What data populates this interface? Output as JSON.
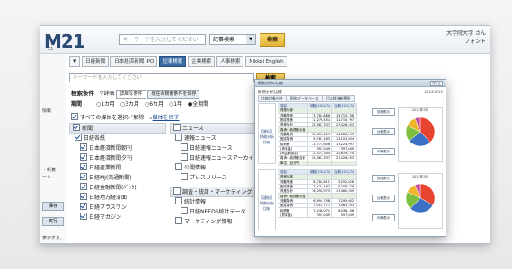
{
  "header": {
    "logo": "M21",
    "logo_sub": "21",
    "keyword_placeholder": "キーワードを入力してください",
    "select_value": "記事検索",
    "search_label": "検索",
    "user_line1": "大学院大学 さん",
    "user_line2": "フォント"
  },
  "left_panel": {
    "t1": "情報",
    "t2": "・新着",
    "t3": "ート",
    "btn1": "保存",
    "btn2": "実行",
    "t4": "表示する。"
  },
  "toolbar": {
    "items": [
      "▼",
      "日経新聞",
      "日本経済新聞 IPO",
      "記事検索",
      "企業検索",
      "人事検索",
      "Nikkei English"
    ]
  },
  "search": {
    "placeholder": "キーワードを入力してください",
    "button": "検索"
  },
  "conditions": {
    "label": "検索条件",
    "detail": "詳細",
    "select": "詳細な条件",
    "btn": "現在の検索条件を保存",
    "period_label": "期間",
    "periods": [
      "1カ月",
      "3カ月",
      "6カ月",
      "1年",
      "全期間"
    ]
  },
  "select_all": {
    "text": "すべての媒体を選択／解除",
    "link": "媒体を探す"
  },
  "media_left": {
    "head": "新聞",
    "group": "日経各紙",
    "items": [
      "日本経済新聞朝刊",
      "日本経済新聞夕刊",
      "日経産業新聞",
      "日経MJ(流通新聞)",
      "日経金融新聞(ﾊﾞｯｸ)",
      "日経地方経済面",
      "日経プラスワン",
      "日経マガジン"
    ]
  },
  "media_right": {
    "head": "ニュース",
    "group1": "速報ニュース",
    "items1": [
      "日経速報ニュース",
      "日経速報ニュースアーカイブ"
    ],
    "group2": "公開情報",
    "items2": [
      "プレスリリース"
    ],
    "head2": "調査・統計・マーケティング",
    "group3": "統計情報",
    "items3": [
      "日経NEEDS統計データ"
    ],
    "group4": "マーケティング情報"
  },
  "popup": {
    "bar": "財務分析の比較",
    "close": "閉じる",
    "title": "財務分析比較",
    "date": "2012/4/10",
    "tabs": [
      "比較対象会社",
      "財務データベース",
      "日本経済新聞社"
    ],
    "sections": [
      {
        "label": "【単体】財務分析比較",
        "header": [
          "項目",
          "前期(2011/3)",
          "当期(2012/3)"
        ],
        "rows": [
          [
            "資産の部",
            "",
            ""
          ],
          [
            "流動資産",
            "13,784,886",
            "15,715,706"
          ],
          [
            "固定資産",
            "11,276,451",
            "11,710,797"
          ],
          [
            "資産合計",
            "25,061,337",
            "27,426,503"
          ],
          [
            "負債・純資産の部",
            "",
            ""
          ],
          [
            "流動負債",
            "12,653,159",
            "14,680,293"
          ],
          [
            "固定負債",
            "9,787,263",
            "11,102,004"
          ],
          [
            "純資産",
            "12,773,606",
            "13,224,997"
          ],
          [
            "(資本金)",
            "397,049",
            "397,049"
          ],
          [
            "(利益剰余金)",
            "12,373,345",
            "12,819,274"
          ],
          [
            "負債・純資産合計",
            "25,061,337",
            "27,426,503"
          ],
          [
            "単位：百万円",
            "",
            ""
          ]
        ],
        "pie_title": "2012年3月"
      },
      {
        "label": "【連結】財務分析比較",
        "header": [
          "項目",
          "前期(2011/3)",
          "当期(2012/3)"
        ],
        "rows": [
          [
            "資産の部",
            "",
            ""
          ],
          [
            "流動資産",
            "8,784,811",
            "9,252,026"
          ],
          [
            "固定資産",
            "7,474,162",
            "8,208,279"
          ],
          [
            "資産合計",
            "16,258,973",
            "17,460,305"
          ],
          [
            "負債・純資産の部",
            "",
            ""
          ],
          [
            "流動負債",
            "6,994,758",
            "7,295,002"
          ],
          [
            "固定負債",
            "7,015,777",
            "7,063,333"
          ],
          [
            "純資産",
            "7,246,071",
            "8,036,108"
          ],
          [
            "(資本金)",
            "397,049",
            "397,049"
          ]
        ],
        "pie_title": "2012年3月"
      }
    ],
    "pie_buttons": [
      "詳細表示",
      "比較表示",
      "印刷表示"
    ],
    "pie_colors": [
      "#e8432f",
      "#3a6fc4",
      "#7fbf3f",
      "#f0b429",
      "#c74aa0"
    ]
  }
}
